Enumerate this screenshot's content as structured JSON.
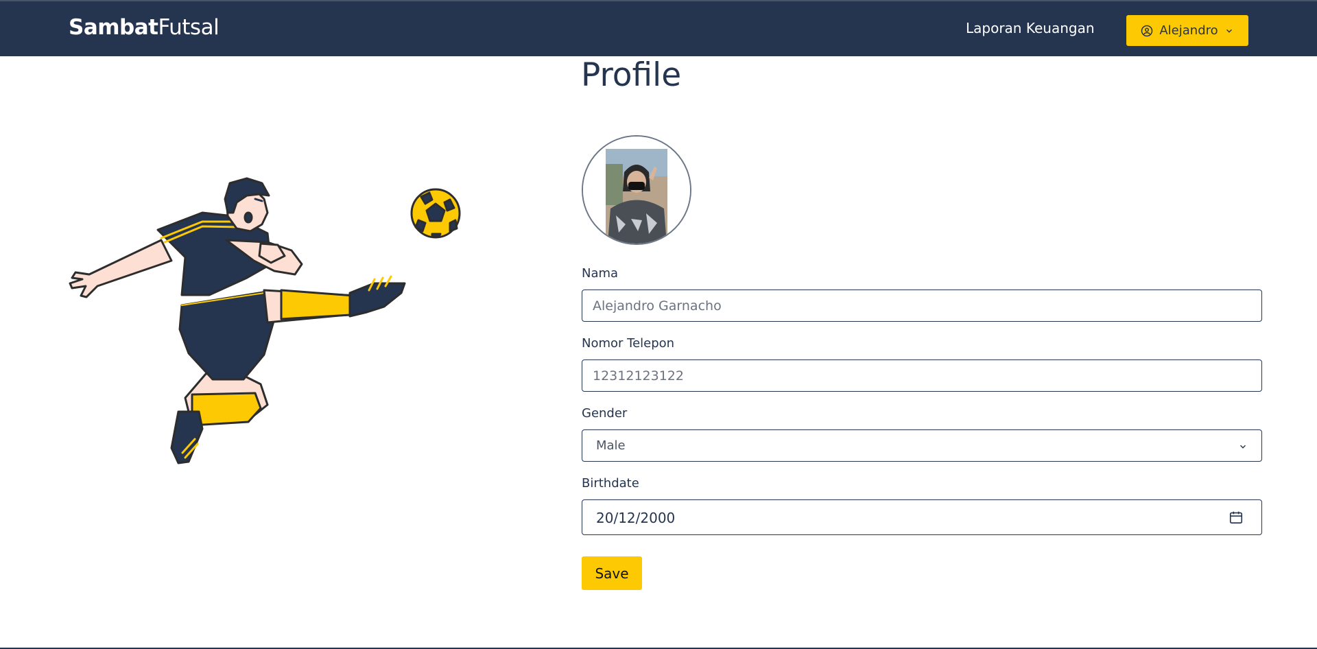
{
  "navbar": {
    "brand_bold": "Sambat",
    "brand_light": "Futsal",
    "link_report": "Laporan Keuangan",
    "user_name": "Alejandro",
    "user_icon": "user-circle-icon",
    "dropdown_icon": "chevron-down-icon"
  },
  "page": {
    "title": "Profile"
  },
  "form": {
    "name_label": "Nama",
    "name_value": "Alejandro Garnacho",
    "phone_label": "Nomor Telepon",
    "phone_value": "12312123122",
    "gender_label": "Gender",
    "gender_value": "Male",
    "birthdate_label": "Birthdate",
    "birthdate_value": "20/12/2000",
    "calendar_icon": "calendar-icon",
    "save_label": "Save"
  },
  "colors": {
    "navbar_bg": "#25344f",
    "accent": "#fdc903",
    "text": "#25344f"
  }
}
